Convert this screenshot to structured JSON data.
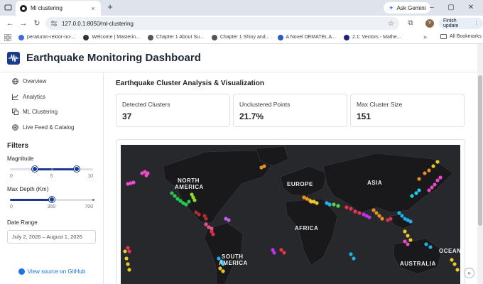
{
  "browser": {
    "tab_title": "Ml clustering",
    "url": "127.0.0.1:8050/ml-clustering",
    "ask_gemini": "Ask Gemini",
    "finish_update": "Finish update",
    "avatar_letter": "Y",
    "bookmarks": [
      {
        "label": "peraturan-rektor-no-...",
        "color": "#3b6fd4"
      },
      {
        "label": "Welcome | Masterin...",
        "color": "#333333"
      },
      {
        "label": "Chapter 1 About Su...",
        "color": "#555555"
      },
      {
        "label": "Chapter 1 Shiny and...",
        "color": "#555555"
      },
      {
        "label": "A Novel DEMATEL A...",
        "color": "#2a5bbf"
      },
      {
        "label": "2.1: Vectors - Mathe...",
        "color": "#1a237e"
      }
    ],
    "all_bookmarks": "All Bookmarks"
  },
  "app": {
    "title": "Earthquake Monitoring Dashboard",
    "brand_color": "#1a3a8c"
  },
  "sidebar": {
    "nav": [
      {
        "label": "Overview",
        "icon": "globe-icon"
      },
      {
        "label": "Analytics",
        "icon": "chart-line-icon"
      },
      {
        "label": "ML Clustering",
        "icon": "cluster-icon"
      },
      {
        "label": "Live Feed & Catalog",
        "icon": "broadcast-icon"
      }
    ],
    "filters_title": "Filters",
    "magnitude": {
      "label": "Magnitude",
      "min": 0,
      "max": 10,
      "low": 3,
      "high": 8,
      "ticks": [
        "0",
        "5",
        "10"
      ]
    },
    "max_depth": {
      "label": "Max Depth (Km)",
      "min": 0,
      "max": 700,
      "value": 350,
      "ticks": [
        "0",
        "350",
        "700"
      ]
    },
    "date_range": {
      "label": "Date Range",
      "value": "July 2, 2026 – August 1, 2026"
    },
    "github": "View source on GitHub"
  },
  "main": {
    "section_title": "Earthquake Cluster Analysis & Visualization",
    "stats": [
      {
        "label": "Detected Clusters",
        "value": "37"
      },
      {
        "label": "Unclustered Points",
        "value": "21.7%"
      },
      {
        "label": "Max Cluster Size",
        "value": "151"
      }
    ],
    "map": {
      "labels": [
        "NORTH",
        "AMERICA",
        "EUROPE",
        "ASIA",
        "AFRICA",
        "SOUTH",
        "AMERICA",
        "AUSTRALIA",
        "OCEAN"
      ],
      "background": "#26282c",
      "land_color": "#1b1b1d"
    }
  }
}
